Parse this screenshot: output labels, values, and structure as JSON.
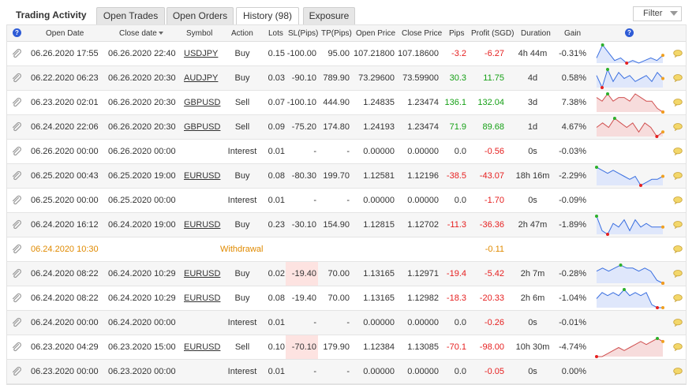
{
  "title": "Trading Activity",
  "tabs": [
    {
      "label": "Open Trades",
      "active": false
    },
    {
      "label": "Open Orders",
      "active": false
    },
    {
      "label": "History (98)",
      "active": true
    },
    {
      "label": "Exposure",
      "active": false
    }
  ],
  "filter_label": "Filter",
  "columns": [
    "Open Date",
    "Close date",
    "Symbol",
    "Action",
    "Lots",
    "SL(Pips)",
    "TP(Pips)",
    "Open Price",
    "Close Price",
    "Pips",
    "Profit (SGD)",
    "Duration",
    "Gain"
  ],
  "colors": {
    "negative": "#e62020",
    "positive": "#16a016",
    "withdrawal": "#e08a00",
    "spark_blue": "#3a6fe0",
    "spark_red": "#d05050"
  },
  "rows": [
    {
      "open_date": "06.26.2020 17:55",
      "close_date": "06.26.2020 22:40",
      "symbol": "USDJPY",
      "action": "Buy",
      "lots": "0.15",
      "sl": "-100.00",
      "tp": "95.00",
      "open_price": "107.21800",
      "close_price": "107.18600",
      "pips": "-3.2",
      "pips_sign": "neg",
      "profit": "-6.27",
      "profit_sign": "neg",
      "duration": "4h 44m",
      "gain": "-0.31%",
      "sl_highlight": false,
      "spark": {
        "color": "blue",
        "values": [
          3,
          8,
          5,
          2,
          3,
          1,
          2,
          1,
          2,
          3,
          2,
          4
        ]
      }
    },
    {
      "open_date": "06.22.2020 06:23",
      "close_date": "06.26.2020 20:30",
      "symbol": "AUDJPY",
      "action": "Buy",
      "lots": "0.03",
      "sl": "-90.10",
      "tp": "789.90",
      "open_price": "73.29600",
      "close_price": "73.59900",
      "pips": "30.3",
      "pips_sign": "pos",
      "profit": "11.75",
      "profit_sign": "pos",
      "duration": "4d",
      "gain": "0.58%",
      "sl_highlight": false,
      "spark": {
        "color": "blue",
        "values": [
          5,
          1,
          7,
          3,
          6,
          4,
          5,
          3,
          4,
          5,
          3,
          6,
          4
        ]
      }
    },
    {
      "open_date": "06.23.2020 02:01",
      "close_date": "06.26.2020 20:30",
      "symbol": "GBPUSD",
      "action": "Sell",
      "lots": "0.07",
      "sl": "-100.10",
      "tp": "444.90",
      "open_price": "1.24835",
      "close_price": "1.23474",
      "pips": "136.1",
      "pips_sign": "pos",
      "profit": "132.04",
      "profit_sign": "pos",
      "duration": "3d",
      "gain": "7.38%",
      "sl_highlight": false,
      "spark": {
        "color": "red",
        "values": [
          5,
          4,
          6,
          4,
          5,
          5,
          4,
          6,
          5,
          4,
          4,
          2,
          1
        ]
      }
    },
    {
      "open_date": "06.24.2020 22:06",
      "close_date": "06.26.2020 20:30",
      "symbol": "GBPUSD",
      "action": "Sell",
      "lots": "0.09",
      "sl": "-75.20",
      "tp": "174.80",
      "open_price": "1.24193",
      "close_price": "1.23474",
      "pips": "71.9",
      "pips_sign": "pos",
      "profit": "89.68",
      "profit_sign": "pos",
      "duration": "1d",
      "gain": "4.67%",
      "sl_highlight": false,
      "spark": {
        "color": "red",
        "values": [
          4,
          5,
          4,
          6,
          5,
          4,
          5,
          3,
          5,
          4,
          2,
          3
        ]
      }
    },
    {
      "open_date": "06.26.2020 00:00",
      "close_date": "06.26.2020 00:00",
      "symbol": "",
      "action": "Interest",
      "lots": "0.01",
      "sl": "-",
      "tp": "-",
      "open_price": "0.00000",
      "close_price": "0.00000",
      "pips": "0.0",
      "pips_sign": "",
      "profit": "-0.56",
      "profit_sign": "neg",
      "duration": "0s",
      "gain": "-0.03%",
      "sl_highlight": false,
      "spark": null
    },
    {
      "open_date": "06.25.2020 00:43",
      "close_date": "06.25.2020 19:00",
      "symbol": "EURUSD",
      "action": "Buy",
      "lots": "0.08",
      "sl": "-80.30",
      "tp": "199.70",
      "open_price": "1.12581",
      "close_price": "1.12196",
      "pips": "-38.5",
      "pips_sign": "neg",
      "profit": "-43.07",
      "profit_sign": "neg",
      "duration": "18h 16m",
      "gain": "-2.29%",
      "sl_highlight": false,
      "spark": {
        "color": "blue",
        "values": [
          7,
          6,
          5,
          6,
          5,
          4,
          3,
          4,
          1,
          2,
          3,
          3,
          4
        ]
      }
    },
    {
      "open_date": "06.25.2020 00:00",
      "close_date": "06.25.2020 00:00",
      "symbol": "",
      "action": "Interest",
      "lots": "0.01",
      "sl": "-",
      "tp": "-",
      "open_price": "0.00000",
      "close_price": "0.00000",
      "pips": "0.0",
      "pips_sign": "",
      "profit": "-1.70",
      "profit_sign": "neg",
      "duration": "0s",
      "gain": "-0.09%",
      "sl_highlight": false,
      "spark": null
    },
    {
      "open_date": "06.24.2020 16:12",
      "close_date": "06.24.2020 19:00",
      "symbol": "EURUSD",
      "action": "Buy",
      "lots": "0.23",
      "sl": "-30.10",
      "tp": "154.90",
      "open_price": "1.12815",
      "close_price": "1.12702",
      "pips": "-11.3",
      "pips_sign": "neg",
      "profit": "-36.36",
      "profit_sign": "neg",
      "duration": "2h 47m",
      "gain": "-1.89%",
      "sl_highlight": false,
      "spark": {
        "color": "blue",
        "values": [
          6,
          2,
          1,
          4,
          3,
          5,
          2,
          5,
          3,
          4,
          3,
          3,
          3
        ]
      }
    },
    {
      "withdrawal": true,
      "open_date": "06.24.2020 10:30",
      "action": "Withdrawal",
      "profit": "-0.11"
    },
    {
      "open_date": "06.24.2020 08:22",
      "close_date": "06.24.2020 10:29",
      "symbol": "EURUSD",
      "action": "Buy",
      "lots": "0.02",
      "sl": "-19.40",
      "tp": "70.00",
      "open_price": "1.13165",
      "close_price": "1.12971",
      "pips": "-19.4",
      "pips_sign": "neg",
      "profit": "-5.42",
      "profit_sign": "neg",
      "duration": "2h 7m",
      "gain": "-0.28%",
      "sl_highlight": true,
      "spark": {
        "color": "blue",
        "values": [
          5,
          6,
          5,
          6,
          7,
          6,
          6,
          5,
          6,
          5,
          2,
          1
        ]
      }
    },
    {
      "open_date": "06.24.2020 08:22",
      "close_date": "06.24.2020 10:29",
      "symbol": "EURUSD",
      "action": "Buy",
      "lots": "0.08",
      "sl": "-19.40",
      "tp": "70.00",
      "open_price": "1.13165",
      "close_price": "1.12982",
      "pips": "-18.3",
      "pips_sign": "neg",
      "profit": "-20.33",
      "profit_sign": "neg",
      "duration": "2h 6m",
      "gain": "-1.04%",
      "sl_highlight": false,
      "spark": {
        "color": "blue",
        "values": [
          4,
          6,
          5,
          6,
          5,
          7,
          5,
          6,
          5,
          6,
          2,
          1,
          1
        ]
      }
    },
    {
      "open_date": "06.24.2020 00:00",
      "close_date": "06.24.2020 00:00",
      "symbol": "",
      "action": "Interest",
      "lots": "0.01",
      "sl": "-",
      "tp": "-",
      "open_price": "0.00000",
      "close_price": "0.00000",
      "pips": "0.0",
      "pips_sign": "",
      "profit": "-0.26",
      "profit_sign": "neg",
      "duration": "0s",
      "gain": "-0.01%",
      "sl_highlight": false,
      "spark": null
    },
    {
      "open_date": "06.23.2020 04:29",
      "close_date": "06.23.2020 15:00",
      "symbol": "EURUSD",
      "action": "Sell",
      "lots": "0.10",
      "sl": "-70.10",
      "tp": "179.90",
      "open_price": "1.12384",
      "close_price": "1.13085",
      "pips": "-70.1",
      "pips_sign": "neg",
      "profit": "-98.00",
      "profit_sign": "neg",
      "duration": "10h 30m",
      "gain": "-4.74%",
      "sl_highlight": true,
      "spark": {
        "color": "red",
        "values": [
          1,
          1,
          2,
          3,
          4,
          3,
          4,
          5,
          6,
          5,
          6,
          7,
          6
        ]
      }
    },
    {
      "open_date": "06.23.2020 00:00",
      "close_date": "06.23.2020 00:00",
      "symbol": "",
      "action": "Interest",
      "lots": "0.01",
      "sl": "-",
      "tp": "-",
      "open_price": "0.00000",
      "close_price": "0.00000",
      "pips": "0.0",
      "pips_sign": "",
      "profit": "-0.05",
      "profit_sign": "neg",
      "duration": "0s",
      "gain": "0.00%",
      "sl_highlight": false,
      "spark": null
    }
  ]
}
